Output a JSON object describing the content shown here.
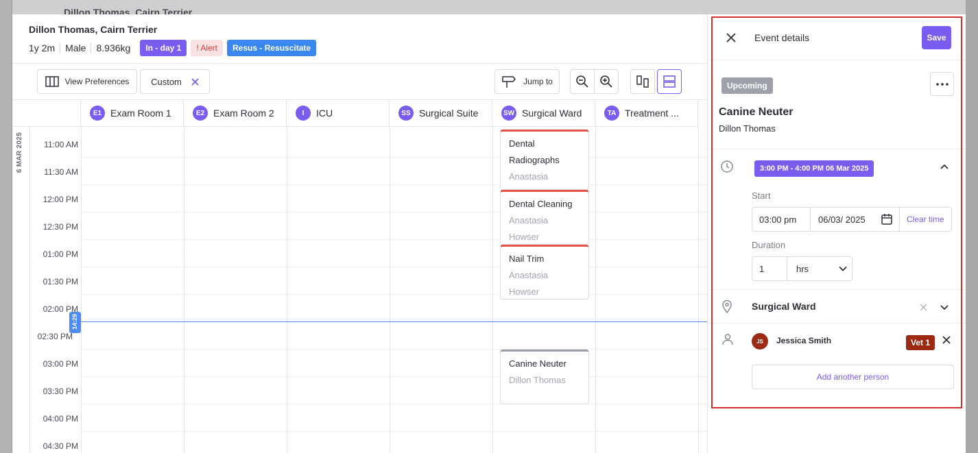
{
  "background": {
    "name": "Dillon Thomas, Cairn Terrier"
  },
  "patient": {
    "name": "Dillon Thomas, Cairn Terrier",
    "age": "1y 2m",
    "sex": "Male",
    "weight": "8.936kg",
    "badges": [
      "In - day 1",
      "! Alert",
      "Resus - Resuscitate"
    ]
  },
  "toolbar": {
    "view_preferences": "View Preferences",
    "custom": "Custom",
    "jump_to": "Jump to"
  },
  "calendar": {
    "date_label": "6 MAR 2025",
    "columns": [
      {
        "initials": "E1",
        "name": "Exam Room 1"
      },
      {
        "initials": "E2",
        "name": "Exam Room 2"
      },
      {
        "initials": "I",
        "name": "ICU"
      },
      {
        "initials": "SS",
        "name": "Surgical Suite"
      },
      {
        "initials": "SW",
        "name": "Surgical Ward"
      },
      {
        "initials": "TA",
        "name": "Treatment ..."
      }
    ],
    "times": [
      "11:00 AM",
      "11:30 AM",
      "12:00 PM",
      "12:30 PM",
      "01:00 PM",
      "01:30 PM",
      "02:00 PM",
      "02:30 PM",
      "03:00 PM",
      "03:30 PM",
      "04:00 PM",
      "04:30 PM"
    ],
    "now_marker": "14:29",
    "events": [
      {
        "title": "Dental Radiographs",
        "line1": "Dental",
        "line2": "Radiographs",
        "people": [
          "Anastasia"
        ]
      },
      {
        "title": "Dental Cleaning",
        "people": [
          "Anastasia",
          "Howser"
        ]
      },
      {
        "title": "Nail Trim",
        "people": [
          "Anastasia",
          "Howser"
        ]
      },
      {
        "title": "Canine Neuter",
        "people": [
          "Dillon Thomas"
        ]
      }
    ]
  },
  "panel": {
    "title": "Event details",
    "save": "Save",
    "status": "Upcoming",
    "event_title": "Canine Neuter",
    "event_subtitle": "Dillon Thomas",
    "time_range": "3:00 PM - 4:00 PM 06 Mar 2025",
    "start_label": "Start",
    "start_time": "03:00 pm",
    "start_date": "06/03/ 2025",
    "clear_time": "Clear time",
    "duration_label": "Duration",
    "duration_value": "1",
    "duration_unit": "hrs",
    "location": "Surgical Ward",
    "person": {
      "initials": "JS",
      "name": "Jessica Smith",
      "role": "Vet 1"
    },
    "add_person": "Add another person"
  },
  "colors": {
    "accent": "#7b5cf0",
    "alert_red": "#d62d2d",
    "now_line": "#4d8cf5",
    "role": "#9d2a14"
  }
}
